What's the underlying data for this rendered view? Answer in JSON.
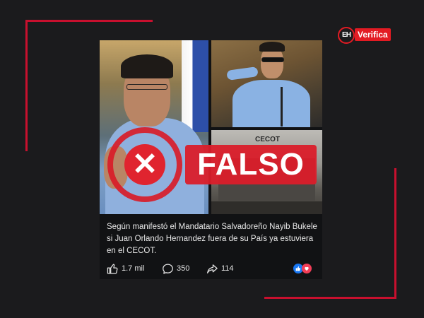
{
  "logo": {
    "mark": "EH",
    "text": "Verifica"
  },
  "post": {
    "stamp": {
      "label": "FALSO",
      "mark": "✕"
    },
    "photo_sign": "CECOT",
    "caption": "Según manifestó el Mandatario Salvadoreño Nayib Bukele si Juan Orlando Hernandez fuera de su País ya estuviera en el CECOT.",
    "actions": {
      "likes": "1.7 mil",
      "comments": "350",
      "shares": "114"
    },
    "reaction_icons": [
      "like-reaction-icon",
      "love-reaction-icon"
    ]
  },
  "colors": {
    "accent": "#e31b23",
    "background": "#1b1b1d",
    "card": "#111214"
  }
}
